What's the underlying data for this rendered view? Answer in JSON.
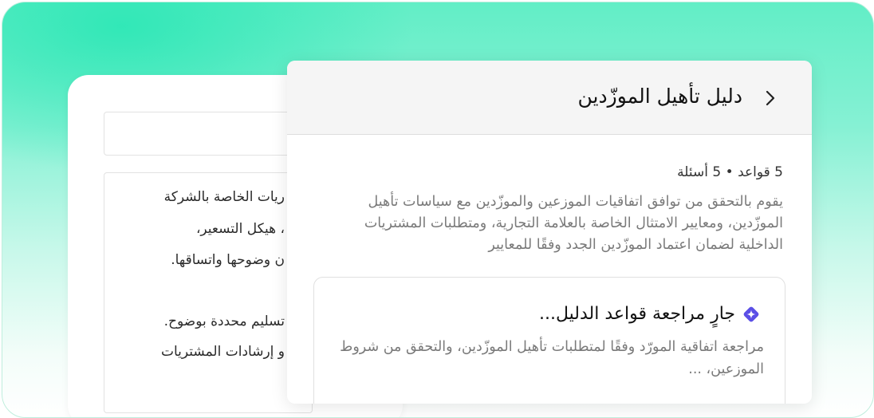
{
  "panel": {
    "title": "دليل تأهيل الموزّدين",
    "meta": "5 قواعد • 5 أسئلة",
    "description": "يقوم بالتحقق من توافق اتفاقيات الموزعين والموزّدين مع سياسات تأهيل الموزّدين، ومعايير الامتثال الخاصة بالعلامة التجارية، ومتطلبات المشتريات الداخلية لضمان اعتماد الموزّدين الجدد وفقًا للمعايير",
    "status": {
      "icon": "sparkle-icon",
      "title": "جارٍ مراجعة قواعد الدليل...",
      "body": "مراجعة اتفاقية المورّد وفقًا لمتطلبات تأهيل الموزّدين، والتحقق من شروط الموزعين، ..."
    }
  },
  "background_document": {
    "lines": [
      "ريات الخاصة بالشركة",
      "، هيكل التسعير،",
      "ن وضوحها واتساقها.",
      "تسليم محددة بوضوح.",
      "و إرشادات المشتريات"
    ]
  },
  "colors": {
    "accent": "#5b4fe6",
    "gradient_top": "#2ee6b2"
  }
}
